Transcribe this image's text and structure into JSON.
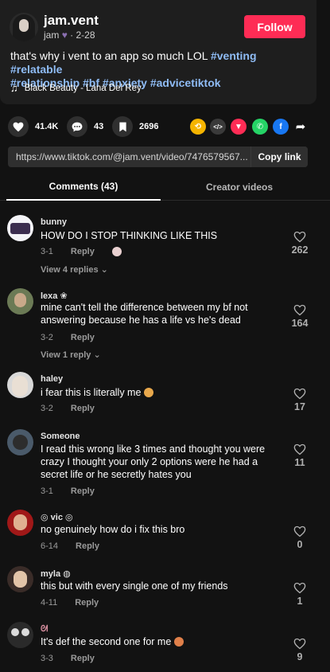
{
  "post": {
    "author": "jam.vent",
    "author_display": "jam",
    "post_date": "2-28",
    "follow_label": "Follow",
    "caption": "that's why i vent to an app so much LOL",
    "hashtags_line1": "#venting #relatable",
    "hashtags_line2": "#relationship #bf #anxiety #advicetiktok",
    "music": "Black Beauty - Lana Del Rey"
  },
  "actions": {
    "likes": "41.4K",
    "comments": "43",
    "saves": "2696"
  },
  "share_icons": [
    "repost-icon",
    "embed-icon",
    "send-icon",
    "whatsapp-icon",
    "facebook-icon",
    "share-arrow-icon"
  ],
  "link": {
    "url": "https://www.tiktok.com/@jam.vent/video/7476579567...",
    "copy_label": "Copy link"
  },
  "tabs": {
    "comments": "Comments (43)",
    "creator": "Creator videos"
  },
  "reply_label": "Reply",
  "comments": [
    {
      "user": "bunny",
      "text": "HOW DO I STOP THINKING LIKE THIS",
      "date": "3-1",
      "likes": "262",
      "view_replies": "View 4 replies"
    },
    {
      "user": "lexa",
      "text": "mine can't tell the difference between my bf not answering because he has a life vs he's dead",
      "date": "3-2",
      "likes": "164",
      "view_replies": "View 1 reply"
    },
    {
      "user": "haley",
      "text": "i fear this is literally me",
      "date": "3-2",
      "likes": "17"
    },
    {
      "user": "Someone",
      "text": "I read this wrong like 3 times and thought you were crazy I thought your only 2 options were he had a secret life or he secretly hates you",
      "date": "3-1",
      "likes": "11"
    },
    {
      "user": "vic",
      "text": "no genuinely how do i fix this bro",
      "date": "6-14",
      "likes": "0"
    },
    {
      "user": "myla",
      "text": "this but with every single one of my friends",
      "date": "4-11",
      "likes": "1"
    },
    {
      "user": "",
      "text": "It's def the second one for me",
      "date": "3-3",
      "likes": "9"
    }
  ],
  "colors": {
    "accent": "#fe2c55",
    "hashtag": "#8fbcf5",
    "background": "#121212",
    "card": "#1e1e1e"
  }
}
